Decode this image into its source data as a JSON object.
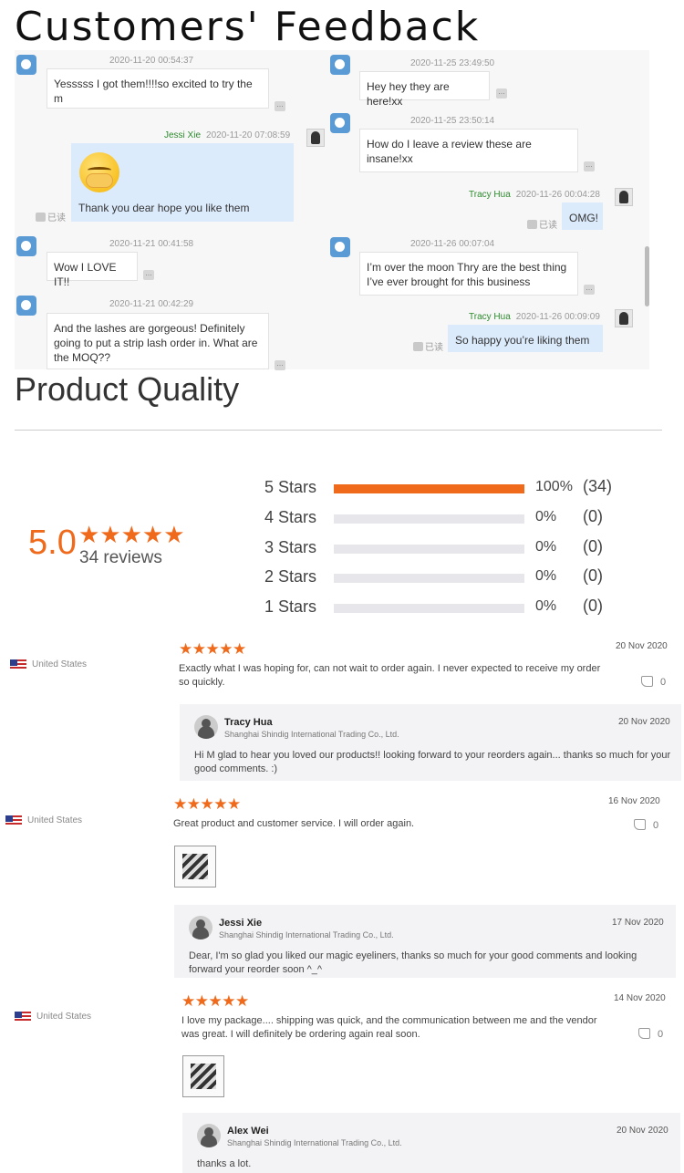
{
  "customers_title": "Customers' Feedback",
  "chat": {
    "left": [
      {
        "time": "2020-11-20 00:54:37",
        "text": "Yesssss I got them!!!!so excited to try the m"
      },
      {
        "name": "Jessi Xie",
        "time": "2020-11-20 07:08:59",
        "text": "Thank you dear hope you like them",
        "read": "已读"
      },
      {
        "time": "2020-11-21 00:41:58",
        "text": "Wow I LOVE IT!!"
      },
      {
        "time": "2020-11-21 00:42:29",
        "text": "And the lashes are gorgeous! Definitely going to put a strip lash order in. What are the MOQ??"
      }
    ],
    "right": [
      {
        "time": "2020-11-25 23:49:50",
        "text": "Hey hey they are here!xx"
      },
      {
        "time": "2020-11-25 23:50:14",
        "text": "How do I leave a review these are insane!xx"
      },
      {
        "name": "Tracy Hua",
        "time": "2020-11-26 00:04:28",
        "text": "OMG!",
        "read": "已读"
      },
      {
        "time": "2020-11-26 00:07:04",
        "text": "I’m over the moon Thry are the best thing I’ve ever brought for this business"
      },
      {
        "name": "Tracy Hua",
        "time": "2020-11-26 00:09:09",
        "text": "So happy you’re liking them",
        "read": "已读"
      }
    ]
  },
  "quality": {
    "title": "Product Quality",
    "average": "5.0",
    "stars_display": "★★★★★",
    "reviews_label": "34 reviews",
    "distribution": [
      {
        "label": "5 Stars",
        "fraction": 1.0,
        "percent": "100%",
        "count": "(34)"
      },
      {
        "label": "4 Stars",
        "fraction": 0,
        "percent": "0%",
        "count": "(0)"
      },
      {
        "label": "3 Stars",
        "fraction": 0,
        "percent": "0%",
        "count": "(0)"
      },
      {
        "label": "2 Stars",
        "fraction": 0,
        "percent": "0%",
        "count": "(0)"
      },
      {
        "label": "1 Stars",
        "fraction": 0,
        "percent": "0%",
        "count": "(0)"
      }
    ]
  },
  "reviews": [
    {
      "country": "United States",
      "stars": "★★★★★",
      "date": "20 Nov 2020",
      "text": "Exactly what I was hoping for, can not wait to order again.  I never expected to receive my order so quickly.",
      "likes": "0",
      "reply": {
        "name": "Tracy Hua",
        "company": "Shanghai Shindig International Trading Co., Ltd.",
        "date": "20 Nov 2020",
        "text": "Hi M          glad to hear you loved our products!! looking forward to your reorders again... thanks so much for your good comments. :)"
      }
    },
    {
      "country": "United States",
      "stars": "★★★★★",
      "date": "16 Nov 2020",
      "text": "Great product and customer service. I will order again.",
      "likes": "0",
      "reply": {
        "name": "Jessi Xie",
        "company": "Shanghai Shindig International Trading Co., Ltd.",
        "date": "17 Nov 2020",
        "text": "Dear, I'm so glad you liked our magic eyeliners,  thanks so much for your good comments and looking forward your reorder soon ^_^"
      }
    },
    {
      "country": "United States",
      "stars": "★★★★★",
      "date": "14 Nov 2020",
      "text": "I love my package.... shipping was quick, and the communication between me and the vendor was great. I will definitely be ordering again real soon.",
      "likes": "0",
      "reply": {
        "name": "Alex Wei",
        "company": "Shanghai Shindig International Trading Co., Ltd.",
        "date": "20 Nov 2020",
        "text": "thanks a lot."
      }
    }
  ],
  "colors": {
    "accent": "#f06a1c",
    "chat_mine": "#dcebfc",
    "sender_name": "#2e8b2e"
  },
  "icons": [
    "user-avatar-icon",
    "seller-avatar-icon",
    "more-dots-icon",
    "read-receipt-icon",
    "us-flag-icon",
    "thumbs-up-icon",
    "star-icon"
  ]
}
